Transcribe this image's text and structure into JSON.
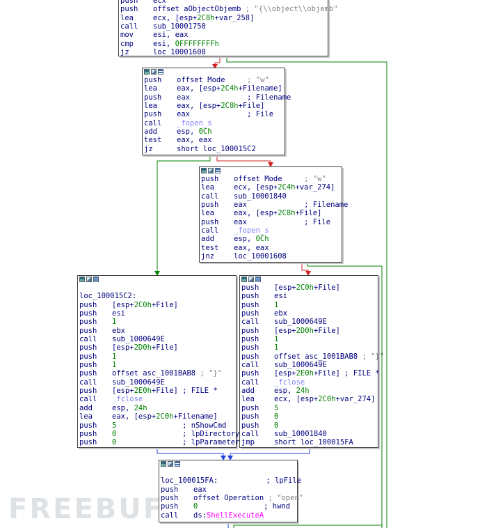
{
  "colors": {
    "edge_true": "#008000",
    "edge_false": "#d02020",
    "edge_uncond": "#2040e0",
    "operand": "#000080",
    "number": "#008000",
    "comment": "#7f7f7f",
    "func_call": "#8080ff",
    "import": "#ff00ff"
  },
  "watermark": "FREEBUF",
  "blocks": [
    {
      "id": "block-top",
      "lines": [
        {
          "m": "push",
          "o": [
            {
              "t": "ecx"
            }
          ]
        },
        {
          "m": "push",
          "o": [
            {
              "t": "offset aObjectObjemb"
            },
            {
              "t": " ; \"{\\\\object\\\\objemb\"",
              "c": "cmt"
            }
          ]
        },
        {
          "m": "lea",
          "o": [
            {
              "t": "ecx, [esp+"
            },
            {
              "t": "2C8h",
              "c": "num"
            },
            {
              "t": "+var_258]"
            }
          ]
        },
        {
          "m": "call",
          "o": [
            {
              "t": "sub_10001750"
            }
          ]
        },
        {
          "m": "mov",
          "o": [
            {
              "t": "esi, eax"
            }
          ]
        },
        {
          "m": "cmp",
          "o": [
            {
              "t": "esi, "
            },
            {
              "t": "0FFFFFFFFh",
              "c": "num"
            }
          ]
        },
        {
          "m": "jz",
          "o": [
            {
              "t": "loc_10001608"
            }
          ]
        }
      ]
    },
    {
      "id": "block-fopen-1",
      "lines": [
        {
          "m": "push",
          "o": [
            {
              "t": "offset Mode     "
            },
            {
              "t": "; \"w\"",
              "c": "cmt"
            }
          ]
        },
        {
          "m": "lea",
          "o": [
            {
              "t": "eax, [esp+"
            },
            {
              "t": "2C4h",
              "c": "num"
            },
            {
              "t": "+Filename]"
            }
          ]
        },
        {
          "m": "push",
          "o": [
            {
              "t": "eax             ; Filename"
            }
          ]
        },
        {
          "m": "lea",
          "o": [
            {
              "t": "eax, [esp+"
            },
            {
              "t": "2C8h",
              "c": "num"
            },
            {
              "t": "+File]"
            }
          ]
        },
        {
          "m": "push",
          "o": [
            {
              "t": "eax             ; File"
            }
          ]
        },
        {
          "m": "call",
          "o": [
            {
              "t": "_fopen_s",
              "c": "fn"
            }
          ]
        },
        {
          "m": "add",
          "o": [
            {
              "t": "esp, "
            },
            {
              "t": "0Ch",
              "c": "num"
            }
          ]
        },
        {
          "m": "test",
          "o": [
            {
              "t": "eax, eax"
            }
          ]
        },
        {
          "m": "jz",
          "o": [
            {
              "t": "short loc_100015C2"
            }
          ]
        }
      ]
    },
    {
      "id": "block-fopen-2",
      "lines": [
        {
          "m": "push",
          "o": [
            {
              "t": "offset Mode     "
            },
            {
              "t": "; \"w\"",
              "c": "cmt"
            }
          ]
        },
        {
          "m": "lea",
          "o": [
            {
              "t": "ecx, [esp+"
            },
            {
              "t": "2C4h",
              "c": "num"
            },
            {
              "t": "+var_274]"
            }
          ]
        },
        {
          "m": "call",
          "o": [
            {
              "t": "sub_10001840"
            }
          ]
        },
        {
          "m": "push",
          "o": [
            {
              "t": "eax             ; Filename"
            }
          ]
        },
        {
          "m": "lea",
          "o": [
            {
              "t": "eax, [esp+"
            },
            {
              "t": "2C8h",
              "c": "num"
            },
            {
              "t": "+File]"
            }
          ]
        },
        {
          "m": "push",
          "o": [
            {
              "t": "eax             ; File"
            }
          ]
        },
        {
          "m": "call",
          "o": [
            {
              "t": "_fopen_s",
              "c": "fn"
            }
          ]
        },
        {
          "m": "add",
          "o": [
            {
              "t": "esp, "
            },
            {
              "t": "0Ch",
              "c": "num"
            }
          ]
        },
        {
          "m": "test",
          "o": [
            {
              "t": "eax, eax"
            }
          ]
        },
        {
          "m": "jnz",
          "o": [
            {
              "t": "loc_10001608"
            }
          ]
        }
      ]
    },
    {
      "id": "block-loc-100015C2",
      "lines": [
        {
          "m": "",
          "o": [
            {
              "t": ""
            }
          ]
        },
        {
          "m": "loc_100015C2:",
          "o": [
            {
              "t": ""
            }
          ]
        },
        {
          "m": "push",
          "o": [
            {
              "t": "[esp+"
            },
            {
              "t": "2C0h",
              "c": "num"
            },
            {
              "t": "+File]"
            }
          ]
        },
        {
          "m": "push",
          "o": [
            {
              "t": "esi"
            }
          ]
        },
        {
          "m": "push",
          "o": [
            {
              "t": "1",
              "c": "num"
            }
          ]
        },
        {
          "m": "push",
          "o": [
            {
              "t": "ebx"
            }
          ]
        },
        {
          "m": "call",
          "o": [
            {
              "t": "sub_1000649E"
            }
          ]
        },
        {
          "m": "push",
          "o": [
            {
              "t": "[esp+"
            },
            {
              "t": "2D0h",
              "c": "num"
            },
            {
              "t": "+File]"
            }
          ]
        },
        {
          "m": "push",
          "o": [
            {
              "t": "1",
              "c": "num"
            }
          ]
        },
        {
          "m": "push",
          "o": [
            {
              "t": "1",
              "c": "num"
            }
          ]
        },
        {
          "m": "push",
          "o": [
            {
              "t": "offset asc_1001BAB8 "
            },
            {
              "t": "; \"}\"",
              "c": "cmt"
            }
          ]
        },
        {
          "m": "call",
          "o": [
            {
              "t": "sub_1000649E"
            }
          ]
        },
        {
          "m": "push",
          "o": [
            {
              "t": "[esp+"
            },
            {
              "t": "2E0h",
              "c": "num"
            },
            {
              "t": "+File] ; FILE *"
            }
          ]
        },
        {
          "m": "call",
          "o": [
            {
              "t": "_fclose",
              "c": "fn"
            }
          ]
        },
        {
          "m": "add",
          "o": [
            {
              "t": "esp, "
            },
            {
              "t": "24h",
              "c": "num"
            }
          ]
        },
        {
          "m": "lea",
          "o": [
            {
              "t": "eax, [esp+"
            },
            {
              "t": "2C0h",
              "c": "num"
            },
            {
              "t": "+Filename]"
            }
          ]
        },
        {
          "m": "push",
          "o": [
            {
              "t": "5",
              "c": "num"
            },
            {
              "t": "               ; nShowCmd"
            }
          ]
        },
        {
          "m": "push",
          "o": [
            {
              "t": "0",
              "c": "num"
            },
            {
              "t": "               ; lpDirectory"
            }
          ]
        },
        {
          "m": "push",
          "o": [
            {
              "t": "0",
              "c": "num"
            },
            {
              "t": "               ; lpParameters"
            }
          ]
        }
      ]
    },
    {
      "id": "block-write-close",
      "lines": [
        {
          "m": "push",
          "o": [
            {
              "t": "[esp+"
            },
            {
              "t": "2C0h",
              "c": "num"
            },
            {
              "t": "+File]"
            }
          ]
        },
        {
          "m": "push",
          "o": [
            {
              "t": "esi"
            }
          ]
        },
        {
          "m": "push",
          "o": [
            {
              "t": "1",
              "c": "num"
            }
          ]
        },
        {
          "m": "push",
          "o": [
            {
              "t": "ebx"
            }
          ]
        },
        {
          "m": "call",
          "o": [
            {
              "t": "sub_1000649E"
            }
          ]
        },
        {
          "m": "push",
          "o": [
            {
              "t": "[esp+"
            },
            {
              "t": "2D0h",
              "c": "num"
            },
            {
              "t": "+File]"
            }
          ]
        },
        {
          "m": "push",
          "o": [
            {
              "t": "1",
              "c": "num"
            }
          ]
        },
        {
          "m": "push",
          "o": [
            {
              "t": "1",
              "c": "num"
            }
          ]
        },
        {
          "m": "push",
          "o": [
            {
              "t": "offset asc_1001BAB8 "
            },
            {
              "t": "; \"}\"",
              "c": "cmt"
            }
          ]
        },
        {
          "m": "call",
          "o": [
            {
              "t": "sub_1000649E"
            }
          ]
        },
        {
          "m": "push",
          "o": [
            {
              "t": "[esp+"
            },
            {
              "t": "2E0h",
              "c": "num"
            },
            {
              "t": "+File] ; FILE *"
            }
          ]
        },
        {
          "m": "call",
          "o": [
            {
              "t": "_fclose",
              "c": "fn"
            }
          ]
        },
        {
          "m": "add",
          "o": [
            {
              "t": "esp, "
            },
            {
              "t": "24h",
              "c": "num"
            }
          ]
        },
        {
          "m": "lea",
          "o": [
            {
              "t": "ecx, [esp+"
            },
            {
              "t": "2C0h",
              "c": "num"
            },
            {
              "t": "+var_274]"
            }
          ]
        },
        {
          "m": "push",
          "o": [
            {
              "t": "5",
              "c": "num"
            }
          ]
        },
        {
          "m": "push",
          "o": [
            {
              "t": "0",
              "c": "num"
            }
          ]
        },
        {
          "m": "push",
          "o": [
            {
              "t": "0",
              "c": "num"
            }
          ]
        },
        {
          "m": "call",
          "o": [
            {
              "t": "sub_10001840"
            }
          ]
        },
        {
          "m": "jmp",
          "o": [
            {
              "t": "short loc_100015FA"
            }
          ]
        }
      ]
    },
    {
      "id": "block-loc-100015FA",
      "lines": [
        {
          "m": "",
          "o": [
            {
              "t": ""
            }
          ]
        },
        {
          "m": "loc_100015FA:",
          "o": [
            {
              "t": "           ; lpFile"
            }
          ]
        },
        {
          "m": "push",
          "o": [
            {
              "t": "eax"
            }
          ]
        },
        {
          "m": "push",
          "o": [
            {
              "t": "offset Operation "
            },
            {
              "t": "; \"open\"",
              "c": "cmt"
            }
          ]
        },
        {
          "m": "push",
          "o": [
            {
              "t": "0",
              "c": "num"
            },
            {
              "t": "               ; hwnd"
            }
          ]
        },
        {
          "m": "call",
          "o": [
            {
              "t": "ds:"
            },
            {
              "t": "ShellExecuteA",
              "c": "imp"
            }
          ]
        }
      ]
    }
  ]
}
